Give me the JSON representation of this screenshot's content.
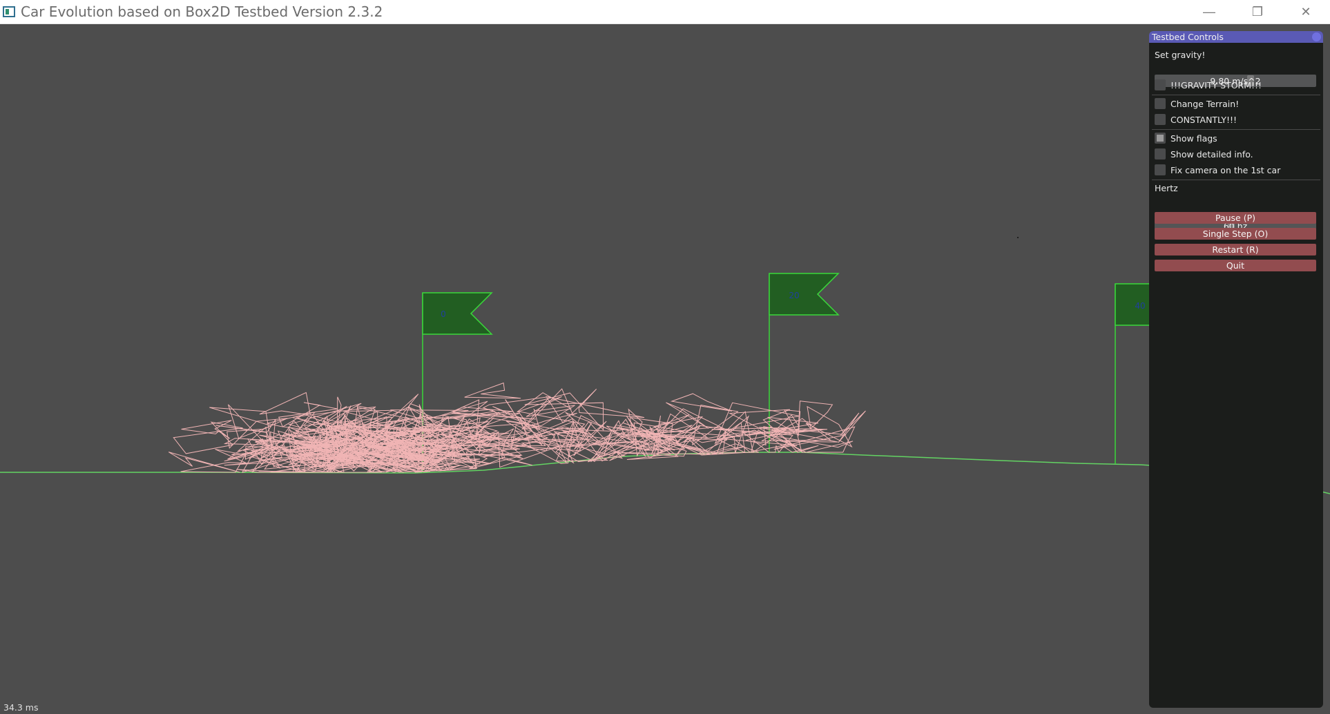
{
  "window": {
    "title": "Car Evolution based on Box2D Testbed Version 2.3.2",
    "controls": {
      "minimize": "—",
      "restore": "❐",
      "close": "✕"
    }
  },
  "scene": {
    "flags": [
      "0",
      "20",
      "40"
    ],
    "colors": {
      "background": "#4d4d4d",
      "ground": "#63d463",
      "flag_fill": "#225e22",
      "flag_stroke": "#3ad83a",
      "flag_text": "#1f3f9f",
      "cars": "#f0b4b4"
    }
  },
  "panel": {
    "title": "Testbed Controls",
    "gravity_label": "Set gravity!",
    "gravity_value": "9.80 m/s^2",
    "gravity_storm": "!!!GRAVITY STORM!!!",
    "change_terrain": "Change Terrain!",
    "constantly": "CONSTANTLY!!!",
    "show_flags": "Show flags",
    "show_detailed": "Show detailed info.",
    "fix_camera": "Fix camera on the 1st car",
    "hertz_label": "Hertz",
    "hertz_value": "60 hz",
    "pause": "Pause (P)",
    "single_step": "Single Step (O)",
    "restart": "Restart (R)",
    "quit": "Quit"
  },
  "status": {
    "frame_time": "34.3 ms"
  }
}
